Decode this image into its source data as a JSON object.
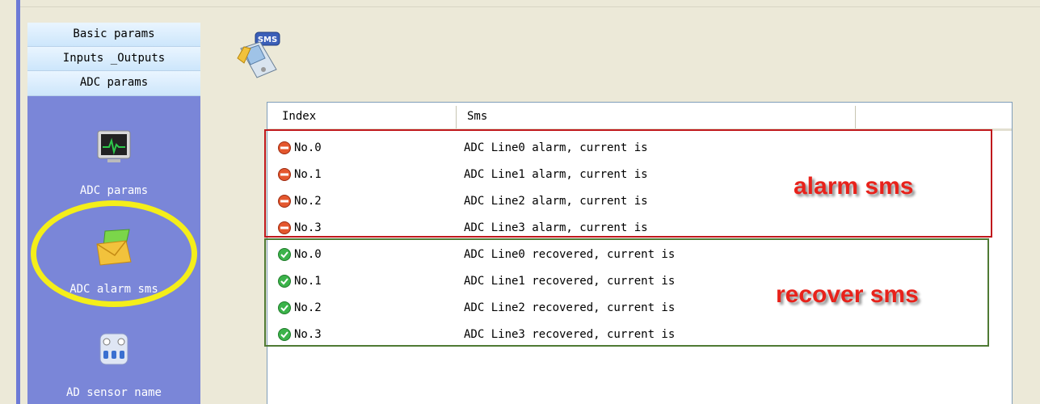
{
  "sidebar": {
    "sections": [
      "Basic params",
      "Inputs _Outputs",
      "ADC params"
    ],
    "items": [
      {
        "label": "ADC params",
        "icon": "monitor-icon"
      },
      {
        "label": "ADC alarm sms",
        "icon": "envelope-icon"
      },
      {
        "label": "AD sensor name",
        "icon": "sensor-icon"
      }
    ]
  },
  "main": {
    "icon": "sms-phone-icon",
    "icon_text": "SMS"
  },
  "table": {
    "columns": [
      "Index",
      "Sms"
    ],
    "rows": [
      {
        "index": "No.0",
        "sms": "ADC Line0 alarm, current is",
        "status": "alarm"
      },
      {
        "index": "No.1",
        "sms": "ADC Line1 alarm, current is",
        "status": "alarm"
      },
      {
        "index": "No.2",
        "sms": "ADC Line2 alarm, current is",
        "status": "alarm"
      },
      {
        "index": "No.3",
        "sms": "ADC Line3 alarm, current is",
        "status": "alarm"
      },
      {
        "index": "No.0",
        "sms": "ADC Line0 recovered, current is",
        "status": "ok"
      },
      {
        "index": "No.1",
        "sms": "ADC Line1 recovered, current is",
        "status": "ok"
      },
      {
        "index": "No.2",
        "sms": "ADC Line2 recovered, current is",
        "status": "ok"
      },
      {
        "index": "No.3",
        "sms": "ADC Line3 recovered, current is",
        "status": "ok"
      }
    ]
  },
  "annotations": {
    "alarm": "alarm sms",
    "recover": "recover sms"
  },
  "colors": {
    "alarm_box": "#c0181c",
    "recover_box": "#4f7a34",
    "annotation_text": "#e8221b",
    "highlight_ring": "#f4ee1a"
  }
}
